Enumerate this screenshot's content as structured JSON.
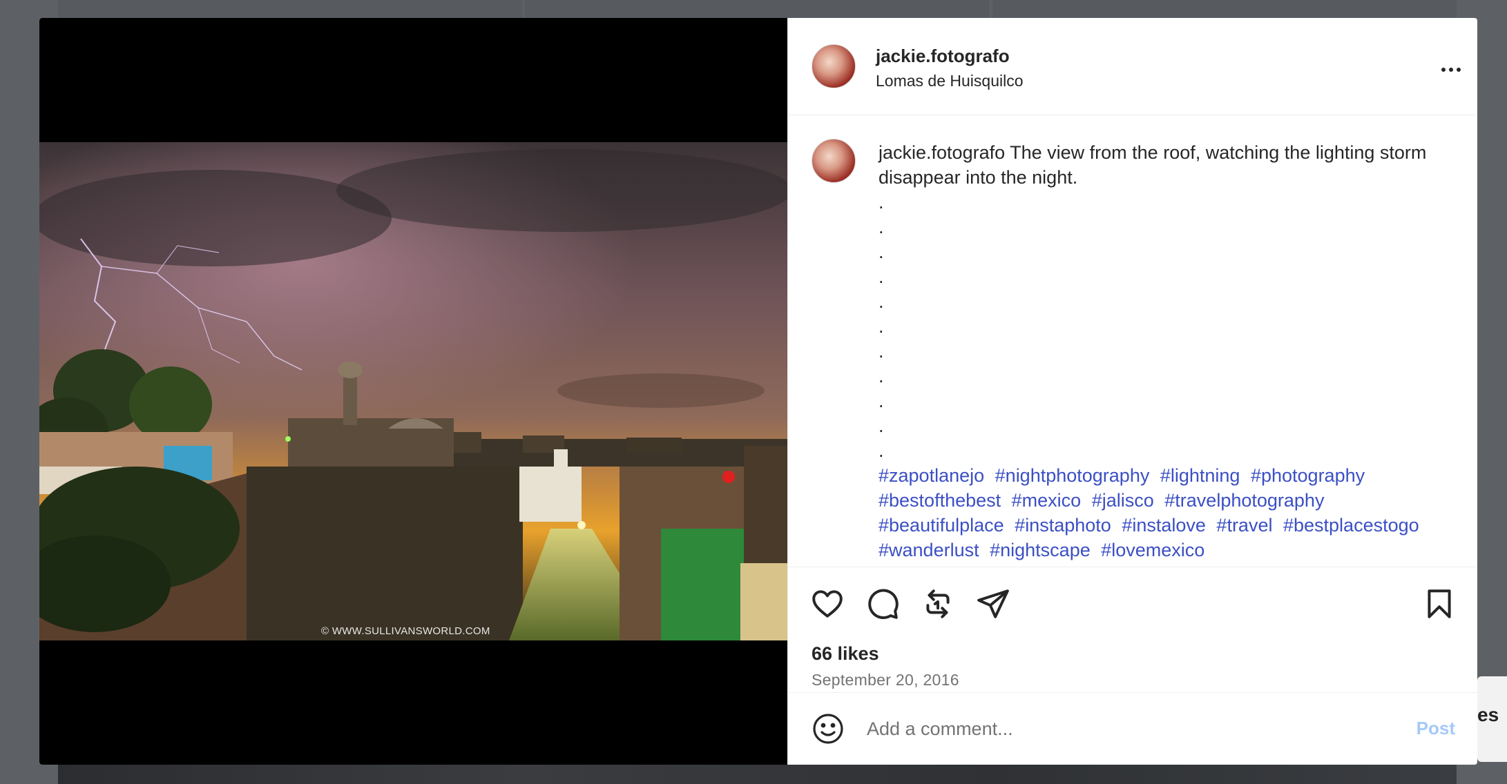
{
  "post": {
    "username": "jackie.fotografo",
    "location": "Lomas de Huisquilco",
    "caption_user": "jackie.fotografo",
    "caption_text": "The view from the roof, watching the lighting storm disappear into the night.",
    "caption_dots": [
      ".",
      ".",
      ".",
      ".",
      ".",
      ".",
      ".",
      ".",
      ".",
      ".",
      "."
    ],
    "hashtags": [
      "#zapotlanejo",
      "#nightphotography",
      "#lightning",
      "#photography",
      "#bestofthebest",
      "#mexico",
      "#jalisco",
      "#travelphotography",
      "#beautifulplace",
      "#instaphoto",
      "#instalove",
      "#travel",
      "#bestplacestogo",
      "#wanderlust",
      "#nightscape",
      "#lovemexico"
    ],
    "likes": "66 likes",
    "date": "September 20, 2016",
    "watermark": "© WWW.SULLIVANSWORLD.COM"
  },
  "comment": {
    "placeholder": "Add a comment...",
    "post_label": "Post"
  },
  "background": {
    "side_text": "es"
  },
  "icons": {
    "more": "more-options-icon",
    "like": "heart-icon",
    "comment": "comment-bubble-icon",
    "repost": "repost-icon",
    "share": "paper-plane-icon",
    "save": "bookmark-icon",
    "emoji": "emoji-icon"
  },
  "colors": {
    "hashtag": "#3b4fc4",
    "post_button_disabled": "#a6c9f7",
    "secondary_text": "#737373"
  }
}
